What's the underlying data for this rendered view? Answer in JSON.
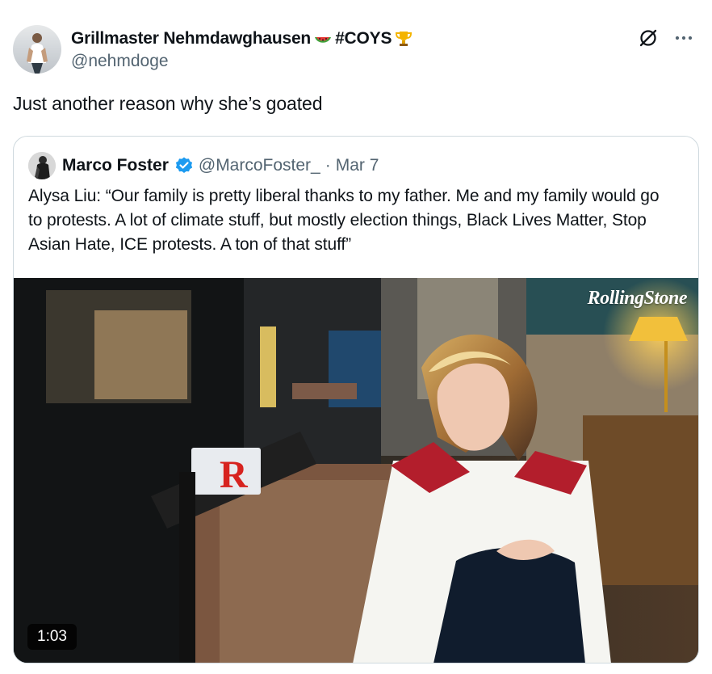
{
  "post": {
    "author": {
      "display_name": "Grillmaster Nehmdawghausen",
      "hashtag": "#COYS",
      "handle": "@nehmdoge",
      "name_emojis": [
        "watermelon-icon",
        "trophy-icon"
      ]
    },
    "text": "Just another reason why she’s goated",
    "actions": {
      "grok_icon": "grok-icon",
      "more_icon": "more-icon"
    }
  },
  "quoted_post": {
    "author": {
      "display_name": "Marco Foster",
      "handle": "@MarcoFoster_",
      "verified": true
    },
    "separator": "·",
    "date": "Mar 7",
    "text": "Alysa Liu: “Our family is pretty liberal thanks to my father. Me and my family would go to protests. A lot of climate stuff, but mostly election things, Black Lives Matter, Stop Asian Hate, ICE protests. A ton of that stuff”",
    "media": {
      "type": "video",
      "duration": "1:03",
      "watermark": "RollingStone"
    }
  },
  "colors": {
    "text_primary": "#0f1419",
    "text_secondary": "#536471",
    "border": "#cfd9de",
    "verified_blue": "#1d9bf0"
  }
}
